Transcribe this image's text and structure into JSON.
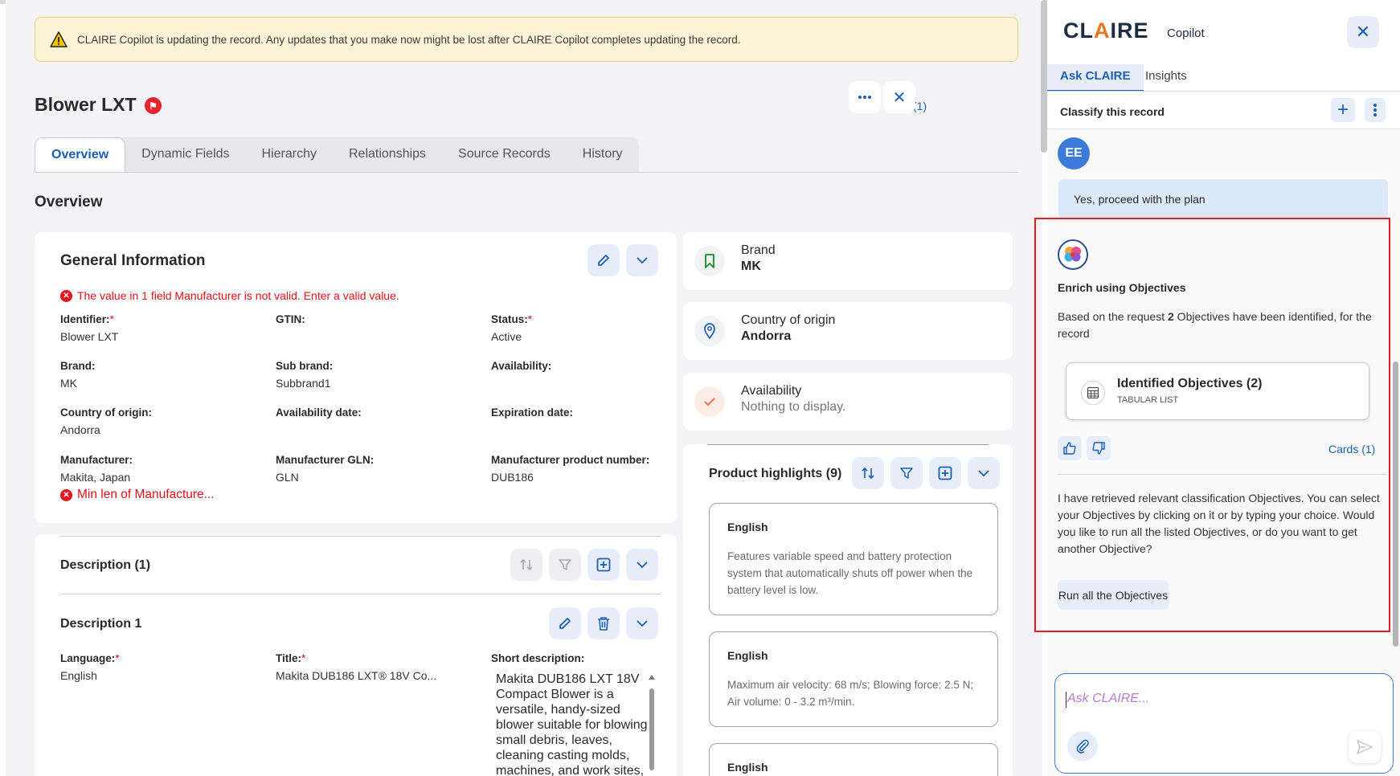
{
  "banner": {
    "text": "CLAIRE Copilot is updating the record. Any updates that you make now might be lost after CLAIRE Copilot completes updating the record."
  },
  "record": {
    "title": "Blower LXT",
    "error_label": "Error (1)"
  },
  "tabs": [
    "Overview",
    "Dynamic Fields",
    "Hierarchy",
    "Relationships",
    "Source Records",
    "History"
  ],
  "overview": {
    "heading": "Overview",
    "general": {
      "title": "General Information",
      "error": "The value in 1 field Manufacturer is not valid. Enter a valid value.",
      "fields": [
        {
          "label": "Identifier:",
          "required": true,
          "value": "Blower LXT"
        },
        {
          "label": "GTIN:",
          "required": false,
          "value": ""
        },
        {
          "label": "Status:",
          "required": true,
          "value": "Active"
        },
        {
          "label": "Brand:",
          "required": false,
          "value": "MK"
        },
        {
          "label": "Sub brand:",
          "required": false,
          "value": "Subbrand1"
        },
        {
          "label": "Availability:",
          "required": false,
          "value": ""
        },
        {
          "label": "Country of origin:",
          "required": false,
          "value": "Andorra"
        },
        {
          "label": "Availability date:",
          "required": false,
          "value": ""
        },
        {
          "label": "Expiration date:",
          "required": false,
          "value": ""
        },
        {
          "label": "Manufacturer:",
          "required": false,
          "value": "Makita, Japan"
        },
        {
          "label": "Manufacturer GLN:",
          "required": false,
          "value": "GLN"
        },
        {
          "label": "Manufacturer product number:",
          "required": false,
          "value": "DUB186"
        }
      ],
      "field_error": "Min len of Manufacture..."
    },
    "description": {
      "title": "Description (1)",
      "item_title": "Description 1",
      "language_label": "Language:",
      "language_value": "English",
      "title_label": "Title:",
      "title_value": "Makita DUB186 LXT® 18V Co...",
      "short_label": "Short description:",
      "short_value": "Makita DUB186 LXT 18V Compact Blower is a versatile, handy-sized blower suitable for blowing small debris, leaves, cleaning casting molds, machines, and work sites,"
    },
    "summary": [
      {
        "label": "Brand",
        "value": "MK",
        "icon": "bookmark-icon",
        "muted": false
      },
      {
        "label": "Country of origin",
        "value": "Andorra",
        "icon": "location-pin-icon",
        "muted": false
      },
      {
        "label": "Availability",
        "value": "Nothing to display.",
        "icon": "check-icon",
        "muted": true
      }
    ],
    "highlights": {
      "title": "Product highlights (9)",
      "items": [
        {
          "lang": "English",
          "text": "Features variable speed and battery protection system that automatically shuts off power when the battery level is low."
        },
        {
          "lang": "English",
          "text": "Maximum air velocity: 68 m/s; Blowing force: 2.5 N; Air volume: 0 - 3.2 m³/min."
        },
        {
          "lang": "English",
          "text": ""
        }
      ]
    }
  },
  "copilot": {
    "logo": "CLAIRE",
    "logo_sub": "Copilot",
    "tabs": [
      "Ask CLAIRE",
      "Insights"
    ],
    "thread_title": "Classify this record",
    "user_initials": "EE",
    "user_message": "Yes, proceed with the plan",
    "enrich_title": "Enrich using Objectives",
    "enrich_text_pre": "Based on the request ",
    "enrich_text_count": "2",
    "enrich_text_post": " Objectives have been identified, for the record",
    "objectives_card_title": "Identified Objectives (2)",
    "objectives_card_sub": "TABULAR LIST",
    "cards_link": "Cards (1)",
    "reply": "I have retrieved relevant classification Objectives. You can select your Objectives by clicking on it or by typing your choice. Would you like to run all the listed Objectives, or do you want to get another Objective?",
    "run_button": "Run all the Objectives",
    "ask_placeholder": "Ask CLAIRE..."
  },
  "colors": {
    "accent": "#1a5fb4",
    "error": "#e3111a",
    "warning_bg": "#fdf3d6",
    "highlight_frame": "#e21d26"
  }
}
